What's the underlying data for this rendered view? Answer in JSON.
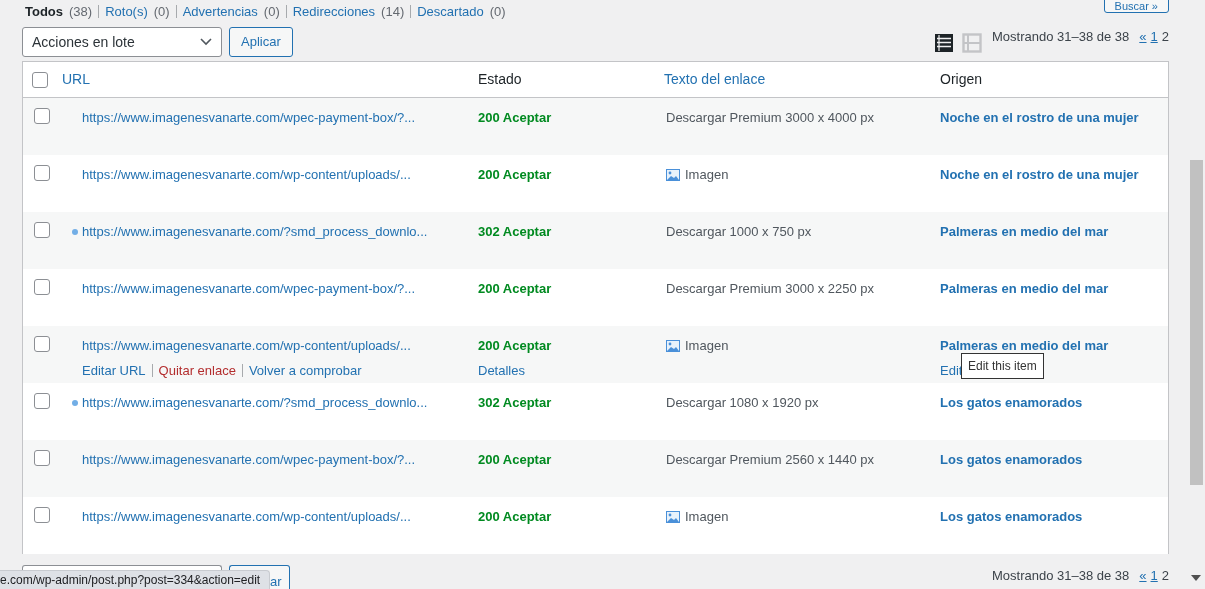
{
  "search_button": "Buscar »",
  "filters": [
    {
      "label": "Todos",
      "count": "(38)",
      "selected": true
    },
    {
      "label": "Roto(s)",
      "count": "(0)",
      "selected": false
    },
    {
      "label": "Advertencias",
      "count": "(0)",
      "selected": false
    },
    {
      "label": "Redirecciones",
      "count": "(14)",
      "selected": false
    },
    {
      "label": "Descartado",
      "count": "(0)",
      "selected": false
    }
  ],
  "bulk_actions": {
    "value": "Acciones en lote",
    "apply": "Aplicar"
  },
  "view_modes": [
    {
      "kind": "list",
      "selected": true
    },
    {
      "kind": "excerpt",
      "selected": false
    }
  ],
  "pagination": {
    "info": "Mostrando 31–38 de 38",
    "pages": [
      {
        "label": "«",
        "selected": false
      },
      {
        "label": "1",
        "selected": false
      },
      {
        "label": "2",
        "selected": true
      }
    ]
  },
  "table": {
    "select_all_checked": false,
    "columns": [
      {
        "label": "URL",
        "sortable": true
      },
      {
        "label": "Estado",
        "sortable": false
      },
      {
        "label": "Texto del enlace",
        "sortable": true
      },
      {
        "label": "Origen",
        "sortable": false
      }
    ],
    "rows": [
      {
        "checked": false,
        "dot": false,
        "url": "https://www.imagenesvanarte.com/wpec-payment-box/?...",
        "status": "200 Aceptar",
        "image_icon": false,
        "link_text": "Descargar Premium 3000 x 4000 px",
        "origin": "Noche en el rostro de una mujer"
      },
      {
        "checked": false,
        "dot": false,
        "url": "https://www.imagenesvanarte.com/wp-content/uploads/...",
        "status": "200 Aceptar",
        "image_icon": true,
        "link_text": "Imagen",
        "origin": "Noche en el rostro de una mujer"
      },
      {
        "checked": false,
        "dot": true,
        "url": "https://www.imagenesvanarte.com/?smd_process_downlo...",
        "status": "302 Aceptar",
        "image_icon": false,
        "link_text": "Descargar 1000 x 750 px",
        "origin": "Palmeras en medio del mar"
      },
      {
        "checked": false,
        "dot": false,
        "url": "https://www.imagenesvanarte.com/wpec-payment-box/?...",
        "status": "200 Aceptar",
        "image_icon": false,
        "link_text": "Descargar Premium 3000 x 2250 px",
        "origin": "Palmeras en medio del mar"
      },
      {
        "checked": false,
        "dot": false,
        "url": "https://www.imagenesvanarte.com/wp-content/uploads/...",
        "status": "200 Aceptar",
        "image_icon": true,
        "link_text": "Imagen",
        "origin": "Palmeras en medio del mar",
        "actions": [
          {
            "label": "Editar URL",
            "kind": "link"
          },
          {
            "label": "Quitar enlace",
            "kind": "delete"
          },
          {
            "label": "Volver a comprobar",
            "kind": "link"
          }
        ],
        "status_action": "Detalles",
        "origin_action": "Edit",
        "tooltip": "Edit this item"
      },
      {
        "checked": false,
        "dot": true,
        "url": "https://www.imagenesvanarte.com/?smd_process_downlo...",
        "status": "302 Aceptar",
        "image_icon": false,
        "link_text": "Descargar 1080 x 1920 px",
        "origin": "Los gatos enamorados"
      },
      {
        "checked": false,
        "dot": false,
        "url": "https://www.imagenesvanarte.com/wpec-payment-box/?...",
        "status": "200 Aceptar",
        "image_icon": false,
        "link_text": "Descargar Premium 2560 x 1440 px",
        "origin": "Los gatos enamorados"
      },
      {
        "checked": false,
        "dot": false,
        "url": "https://www.imagenesvanarte.com/wp-content/uploads/...",
        "status": "200 Aceptar",
        "image_icon": true,
        "link_text": "Imagen",
        "origin": "Los gatos enamorados"
      }
    ]
  },
  "bottom_apply": "ar",
  "bottom_pagination": {
    "info": "Mostrando 31–38 de 38",
    "pages": [
      {
        "label": "«",
        "selected": false
      },
      {
        "label": "1",
        "selected": false
      },
      {
        "label": "2",
        "selected": true
      }
    ]
  },
  "status_bar": "e.com/wp-admin/post.php?post=334&action=edit"
}
